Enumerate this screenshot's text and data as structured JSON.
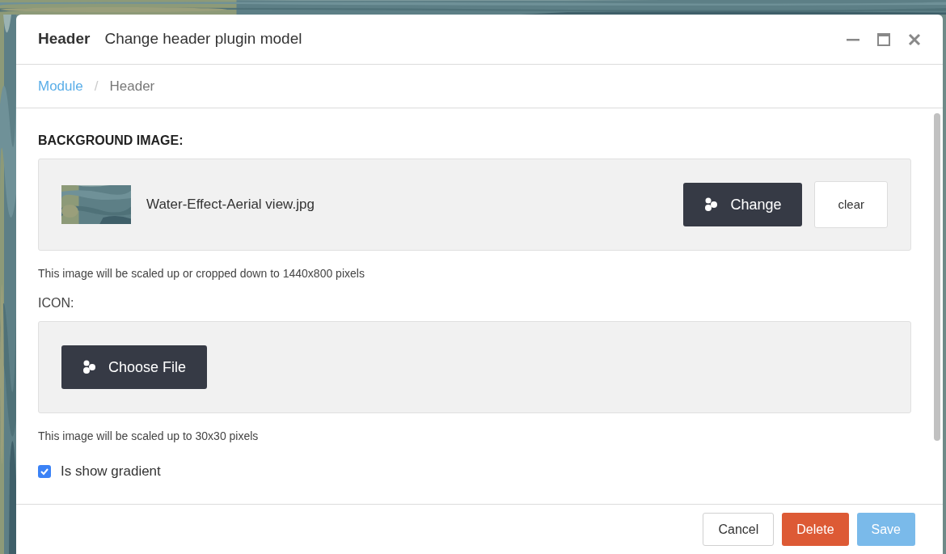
{
  "dialog": {
    "title_bold": "Header",
    "title": "Change header plugin model"
  },
  "breadcrumb_separator": "/",
  "breadcrumb": [
    {
      "label": "Module",
      "kind": "link"
    },
    {
      "label": "Header",
      "kind": "current"
    }
  ],
  "fields": [
    {
      "label": "BACKGROUND IMAGE:",
      "strong": true,
      "file_name": "Water-Effect-Aerial view.jpg",
      "has_file": true,
      "buttons": [
        "Change",
        "clear"
      ],
      "help": "This image will be scaled up or cropped down to 1440x800 pixels"
    },
    {
      "label": "ICON:",
      "strong": false,
      "has_file": false,
      "buttons": [
        "Choose File"
      ],
      "help": "This image will be scaled up to 30x30 pixels"
    }
  ],
  "gradient": {
    "label": "Is show gradient",
    "checked": true
  },
  "footer": [
    {
      "label": "Cancel",
      "kind": "default",
      "disabled": false
    },
    {
      "label": "Delete",
      "kind": "danger",
      "disabled": false
    },
    {
      "label": "Save",
      "kind": "primary",
      "disabled": true
    }
  ]
}
